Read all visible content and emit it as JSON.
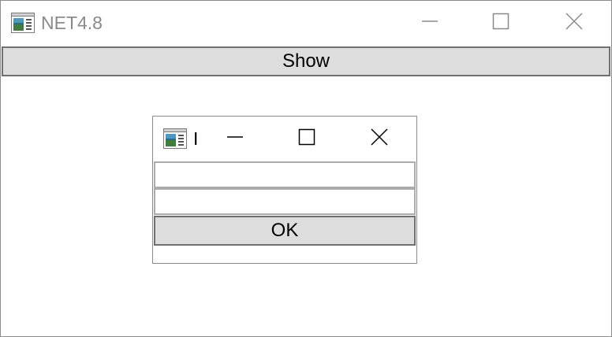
{
  "main_window": {
    "title": "NET4.8",
    "icon": "app-window-icon",
    "controls": {
      "minimize_icon": "minimize-icon",
      "maximize_icon": "maximize-icon",
      "close_icon": "close-icon"
    },
    "show_button_label": "Show"
  },
  "dialog": {
    "title": "I",
    "icon": "app-window-icon",
    "controls": {
      "minimize_icon": "minimize-icon",
      "maximize_icon": "maximize-icon",
      "close_icon": "close-icon"
    },
    "input1_value": "",
    "input2_value": "",
    "ok_button_label": "OK"
  },
  "colors": {
    "button_face": "#dddddd",
    "button_border": "#707070",
    "input_border": "#acacac",
    "inactive_title": "#8a8a8a",
    "window_border": "#8c8c8c"
  }
}
